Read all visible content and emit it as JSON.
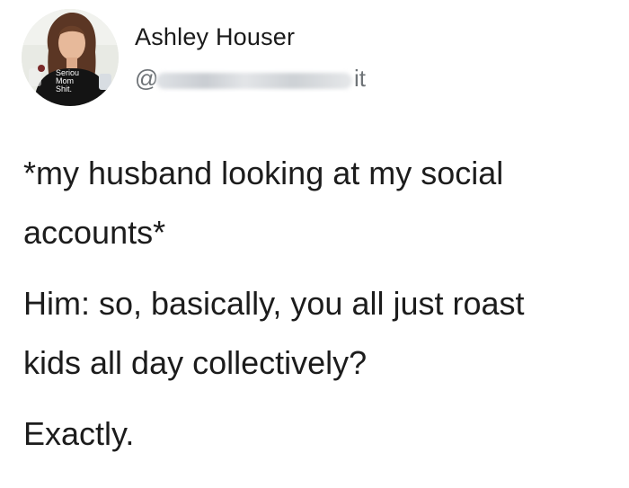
{
  "tweet": {
    "author": {
      "name": "Ashley Houser",
      "handle_prefix": "@",
      "handle_suffix": "it",
      "avatar_shirt_text": [
        "Seriou",
        "Mom",
        "Shit."
      ]
    },
    "paragraphs": [
      "*my husband looking at my social\naccounts*",
      "Him: so, basically, you all just roast\nkids all day collectively?",
      "Exactly."
    ]
  },
  "colors": {
    "background": "#ffffff",
    "text": "#1c1c1c",
    "handle": "#6f7478"
  }
}
